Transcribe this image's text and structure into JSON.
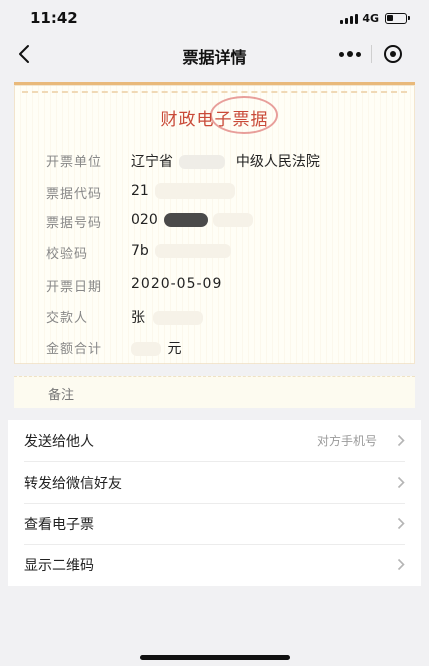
{
  "status_bar": {
    "time": "11:42",
    "network": "4G"
  },
  "nav": {
    "title": "票据详情"
  },
  "invoice": {
    "title": "财政电子票据",
    "fields": [
      {
        "label": "开票单位",
        "value": "辽宁省",
        "value_suffix": "中级人民法院"
      },
      {
        "label": "票据代码",
        "value": "21"
      },
      {
        "label": "票据号码",
        "value": "020"
      },
      {
        "label": "校验码",
        "value": "7b"
      },
      {
        "label": "开票日期",
        "value": "2020-05-09"
      },
      {
        "label": "交款人",
        "value": "张"
      },
      {
        "label": "金额合计",
        "value": "元"
      }
    ],
    "remark_label": "备注"
  },
  "menu": {
    "items": [
      {
        "label": "发送给他人",
        "hint": "对方手机号"
      },
      {
        "label": "转发给微信好友"
      },
      {
        "label": "查看电子票"
      },
      {
        "label": "显示二维码"
      }
    ]
  }
}
